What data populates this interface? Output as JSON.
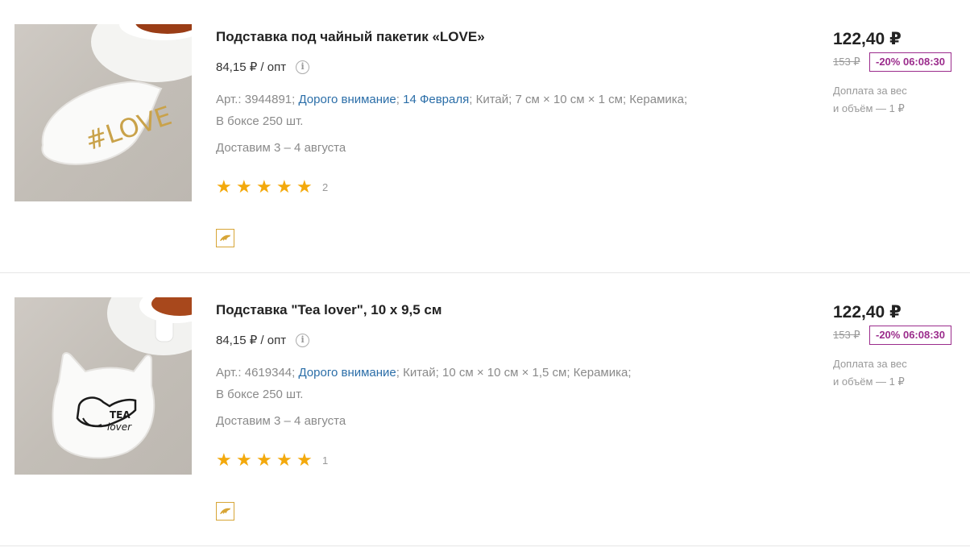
{
  "products": [
    {
      "title": "Подставка под чайный пакетик «LOVE»",
      "opt_price": "84,15 ₽ / опт",
      "props_prefix": "Арт.: 3944891;",
      "links": [
        "Дорого внимание",
        "14 Февраля"
      ],
      "props_rest": "Китай;  7 см × 10 см × 1 см;  Керамика;",
      "box": "В боксе 250 шт.",
      "delivery": "Доставим 3 – 4 августа",
      "rating_count": "2",
      "price": "122,40 ₽",
      "old_price": "153 ₽",
      "discount": "-20% 06:08:30",
      "surcharge_line1": "Доплата за вес",
      "surcharge_line2": "и объём — 1 ₽",
      "image_text": "#LOVE"
    },
    {
      "title": "Подставка \"Tea lover\", 10 х 9,5 см",
      "opt_price": "84,15 ₽ / опт",
      "props_prefix": "Арт.: 4619344;",
      "links": [
        "Дорого внимание"
      ],
      "props_rest": "Китай;  10 см × 10 см × 1,5 см;  Керамика;",
      "box": "В боксе 250 шт.",
      "delivery": "Доставим 3 – 4 августа",
      "rating_count": "1",
      "price": "122,40 ₽",
      "old_price": "153 ₽",
      "discount": "-20% 06:08:30",
      "surcharge_line1": "Доплата за вес",
      "surcharge_line2": "и объём — 1 ₽",
      "image_text_1": "TEA",
      "image_text_2": "lover"
    }
  ],
  "colors": {
    "star": "#f3a90c",
    "link": "#2b6ea8",
    "discount": "#9b2c8c",
    "badge_border": "#d7a536"
  },
  "icons": {
    "info": "info-circle-icon",
    "star": "star-icon",
    "badge": "dolphin-icon"
  }
}
